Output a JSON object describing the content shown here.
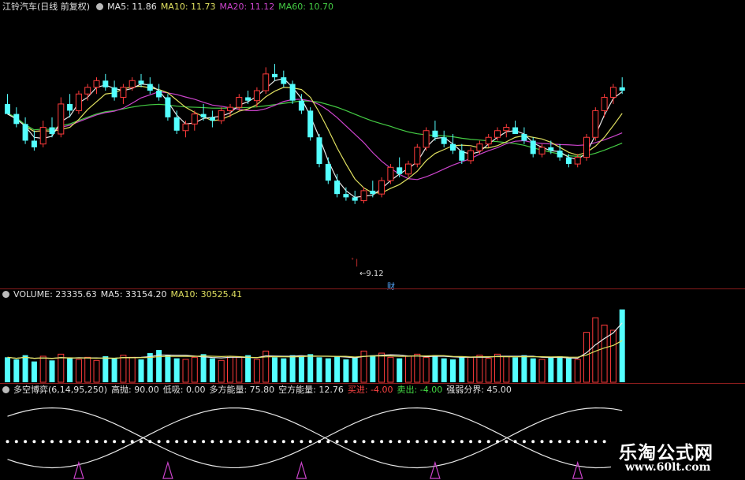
{
  "price_panel": {
    "stock_name": "江铃汽车(日线 前复权)",
    "ma5": "MA5: 11.86",
    "ma10": "MA10: 11.73",
    "ma20": "MA20: 11.12",
    "ma60": "MA60: 10.70",
    "low_marker": "9.12",
    "cai_marker": "财",
    "colors": {
      "up": "#ff3b3b",
      "down": "#54ffff",
      "ma5": "#e8e8e8",
      "ma10": "#e0e060",
      "ma20": "#cc44cc",
      "ma60": "#44cc44"
    }
  },
  "volume_panel": {
    "volume": "VOLUME: 23335.63",
    "ma5": "MA5: 33154.20",
    "ma10": "MA10: 30525.41"
  },
  "indicator_panel": {
    "name": "多空博弈(6,14,95,250)",
    "high": "高抛: 90.00",
    "low": "低吸: 0.00",
    "long_energy": "多方能量: 75.80",
    "short_energy": "空方能量: 12.76",
    "buy": "买进: -4.00",
    "sell": "卖出: -4.00",
    "boundary": "强弱分界: 45.00"
  },
  "watermark": {
    "title": "乐淘公式网",
    "url": "www.60lt.com"
  },
  "chart_data": {
    "type": "candlestick",
    "ohlc_approx_price_levels": [
      [
        12.1,
        12.4,
        11.9,
        11.8
      ],
      [
        11.8,
        12.0,
        11.4,
        11.5
      ],
      [
        11.5,
        11.7,
        10.9,
        11.0
      ],
      [
        11.0,
        11.3,
        10.7,
        10.8
      ],
      [
        10.9,
        11.6,
        10.8,
        11.4
      ],
      [
        11.4,
        11.7,
        11.1,
        11.2
      ],
      [
        11.2,
        12.3,
        11.1,
        12.1
      ],
      [
        12.1,
        12.4,
        11.7,
        11.9
      ],
      [
        11.9,
        12.5,
        11.8,
        12.4
      ],
      [
        12.4,
        12.7,
        12.2,
        12.6
      ],
      [
        12.6,
        12.9,
        12.4,
        12.8
      ],
      [
        12.8,
        13.0,
        12.5,
        12.6
      ],
      [
        12.6,
        12.8,
        12.2,
        12.3
      ],
      [
        12.3,
        12.7,
        12.1,
        12.6
      ],
      [
        12.6,
        12.9,
        12.5,
        12.8
      ],
      [
        12.8,
        13.0,
        12.6,
        12.7
      ],
      [
        12.7,
        12.9,
        12.4,
        12.5
      ],
      [
        12.5,
        12.7,
        12.2,
        12.3
      ],
      [
        12.3,
        12.4,
        11.6,
        11.7
      ],
      [
        11.7,
        11.9,
        11.2,
        11.3
      ],
      [
        11.3,
        11.6,
        11.1,
        11.5
      ],
      [
        11.5,
        11.9,
        11.3,
        11.8
      ],
      [
        11.8,
        12.1,
        11.6,
        11.7
      ],
      [
        11.7,
        11.9,
        11.4,
        11.6
      ],
      [
        11.6,
        12.0,
        11.5,
        11.9
      ],
      [
        11.9,
        12.1,
        11.7,
        12.0
      ],
      [
        12.0,
        12.4,
        11.9,
        12.3
      ],
      [
        12.3,
        12.5,
        12.1,
        12.2
      ],
      [
        12.2,
        12.6,
        12.0,
        12.5
      ],
      [
        12.5,
        13.2,
        12.4,
        13.0
      ],
      [
        13.0,
        13.3,
        12.8,
        12.9
      ],
      [
        12.9,
        13.1,
        12.6,
        12.7
      ],
      [
        12.7,
        12.8,
        12.1,
        12.2
      ],
      [
        12.2,
        12.4,
        11.8,
        11.9
      ],
      [
        11.9,
        12.0,
        11.0,
        11.1
      ],
      [
        11.1,
        11.2,
        10.2,
        10.3
      ],
      [
        10.3,
        10.5,
        9.7,
        9.8
      ],
      [
        9.8,
        10.0,
        9.3,
        9.4
      ],
      [
        9.4,
        9.6,
        9.2,
        9.3
      ],
      [
        9.3,
        9.5,
        9.1,
        9.2
      ],
      [
        9.2,
        9.6,
        9.12,
        9.5
      ],
      [
        9.5,
        9.8,
        9.3,
        9.4
      ],
      [
        9.4,
        9.9,
        9.3,
        9.8
      ],
      [
        9.8,
        10.3,
        9.7,
        10.2
      ],
      [
        10.2,
        10.5,
        9.9,
        10.0
      ],
      [
        10.0,
        10.4,
        9.9,
        10.3
      ],
      [
        10.3,
        10.9,
        10.2,
        10.8
      ],
      [
        10.8,
        11.4,
        10.7,
        11.3
      ],
      [
        11.3,
        11.6,
        11.0,
        11.1
      ],
      [
        11.1,
        11.3,
        10.8,
        10.9
      ],
      [
        10.9,
        11.2,
        10.6,
        10.7
      ],
      [
        10.7,
        10.9,
        10.3,
        10.4
      ],
      [
        10.4,
        10.8,
        10.3,
        10.7
      ],
      [
        10.7,
        11.0,
        10.6,
        10.9
      ],
      [
        10.9,
        11.2,
        10.8,
        11.1
      ],
      [
        11.1,
        11.4,
        11.0,
        11.3
      ],
      [
        11.3,
        11.5,
        11.1,
        11.4
      ],
      [
        11.4,
        11.6,
        11.2,
        11.2
      ],
      [
        11.2,
        11.4,
        10.9,
        11.0
      ],
      [
        11.0,
        11.1,
        10.5,
        10.6
      ],
      [
        10.6,
        10.9,
        10.5,
        10.8
      ],
      [
        10.8,
        11.0,
        10.6,
        10.7
      ],
      [
        10.7,
        10.9,
        10.4,
        10.5
      ],
      [
        10.5,
        10.6,
        10.2,
        10.3
      ],
      [
        10.3,
        10.6,
        10.2,
        10.5
      ],
      [
        10.5,
        11.2,
        10.4,
        11.1
      ],
      [
        11.1,
        12.0,
        11.0,
        11.9
      ],
      [
        11.9,
        12.4,
        11.7,
        12.3
      ],
      [
        12.3,
        12.7,
        12.1,
        12.6
      ],
      [
        12.6,
        12.9,
        12.4,
        12.5
      ]
    ],
    "volume_approx": [
      24000,
      22000,
      26000,
      20000,
      25000,
      21000,
      27000,
      23000,
      22000,
      24000,
      21000,
      25000,
      23000,
      26000,
      24000,
      22000,
      28000,
      31000,
      26000,
      23000,
      22000,
      24000,
      27000,
      23000,
      21000,
      25000,
      24000,
      26000,
      22000,
      30000,
      24000,
      23000,
      26000,
      25000,
      27000,
      24000,
      23000,
      25000,
      22000,
      24000,
      30000,
      26000,
      28000,
      24000,
      23000,
      25000,
      27000,
      24000,
      26000,
      23000,
      22000,
      25000,
      24000,
      26000,
      23000,
      27000,
      25000,
      24000,
      26000,
      23000,
      22000,
      24000,
      25000,
      23000,
      22000,
      48000,
      62000,
      55000,
      50000,
      70000
    ]
  }
}
